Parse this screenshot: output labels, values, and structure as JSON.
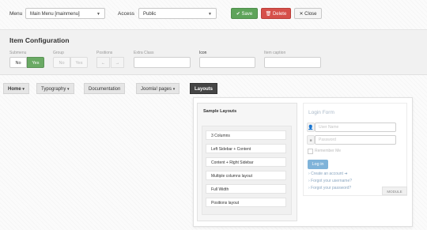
{
  "toolbar": {
    "menu_label": "Menu",
    "menu_value": "Main Menu [mainmenu]",
    "access_label": "Access",
    "access_value": "Public",
    "save_label": "Save",
    "delete_label": "Delete",
    "close_label": "Close"
  },
  "item_config": {
    "title": "Item Configuration",
    "fields": {
      "submenu": {
        "label": "Submenu",
        "no": "No",
        "yes": "Yes"
      },
      "group": {
        "label": "Group",
        "no": "No",
        "yes": "Yes"
      },
      "positions": {
        "label": "Positions"
      },
      "extra_class": {
        "label": "Extra Class"
      },
      "icon": {
        "label": "Icon"
      },
      "caption": {
        "label": "Item caption"
      }
    }
  },
  "nav": [
    {
      "label": "Home"
    },
    {
      "label": "Typography"
    },
    {
      "label": "Documentation"
    },
    {
      "label": "Joomla! pages"
    },
    {
      "label": "Layouts"
    }
  ],
  "dropdown": {
    "title": "Sample Layouts",
    "items": [
      "3 Columns",
      "Left Sidebar + Content",
      "Content + Right Sidebar",
      "Multiple columns layout",
      "Full Width",
      "Positions layout"
    ]
  },
  "login": {
    "title": "Login Form",
    "username_placeholder": "User Name",
    "password_placeholder": "Password",
    "remember": "Remember Me",
    "login_button": "Log in",
    "create_account": "Create an account",
    "forgot_username": "Forgot your username?",
    "forgot_password": "Forgot your password?",
    "module_tag": "MODULE"
  },
  "colors": {
    "save": "#5ea45a",
    "delete": "#d6504a",
    "active_nav": "#454545",
    "toggle_yes": "#6aaa64"
  }
}
